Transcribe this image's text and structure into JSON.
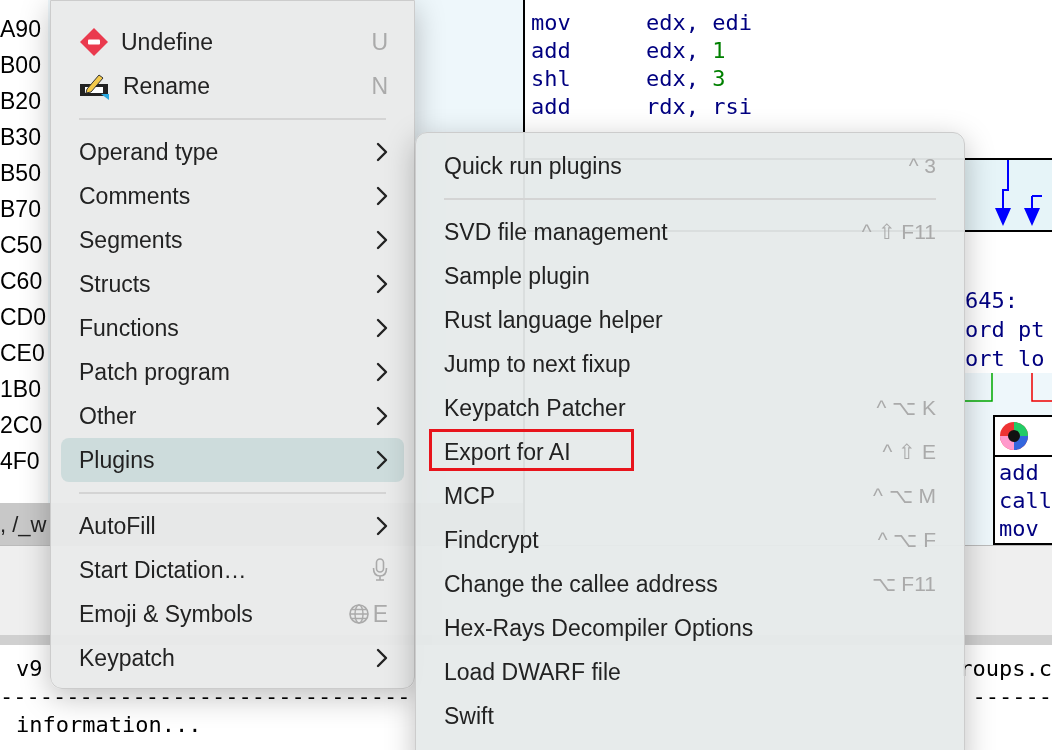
{
  "background": {
    "addresses": [
      "A90",
      "B00",
      "B20",
      "B30",
      "B50",
      "B70",
      "C50",
      "C60",
      "CD0",
      "CE0",
      "1B0",
      "2C0",
      "4F0"
    ],
    "tab_fragment": ", /_w",
    "code": [
      {
        "mnemonic": "mov",
        "operands": [
          {
            "text": "edx, edi",
            "kind": "reg"
          }
        ]
      },
      {
        "mnemonic": "add",
        "operands": [
          {
            "text": "edx, ",
            "kind": "reg"
          },
          {
            "text": "1",
            "kind": "num"
          }
        ]
      },
      {
        "mnemonic": "shl",
        "operands": [
          {
            "text": "edx, ",
            "kind": "reg"
          },
          {
            "text": "3",
            "kind": "num"
          }
        ]
      },
      {
        "mnemonic": "add",
        "operands": [
          {
            "text": "rdx, rsi",
            "kind": "reg"
          }
        ]
      }
    ],
    "graph_text": [
      "645:",
      "ord pt",
      "ort lo"
    ],
    "graph_block": [
      "add",
      "call",
      "mov"
    ],
    "output": {
      "version": "v9",
      "tail": "roups.c",
      "rule_left": "-------------------------------",
      "rule_right": "------",
      "info": "information..."
    }
  },
  "context_menu": [
    {
      "kind": "undefine",
      "label": "Undefine",
      "shortcut": "U",
      "submenu": false,
      "selected": false
    },
    {
      "kind": "rename",
      "label": "Rename",
      "shortcut": "N",
      "submenu": false,
      "selected": false
    },
    {
      "kind": "separator"
    },
    {
      "kind": "item",
      "label": "Operand type",
      "submenu": true,
      "selected": false
    },
    {
      "kind": "item",
      "label": "Comments",
      "submenu": true,
      "selected": false
    },
    {
      "kind": "item",
      "label": "Segments",
      "submenu": true,
      "selected": false
    },
    {
      "kind": "item",
      "label": "Structs",
      "submenu": true,
      "selected": false
    },
    {
      "kind": "item",
      "label": "Functions",
      "submenu": true,
      "selected": false
    },
    {
      "kind": "item",
      "label": "Patch program",
      "submenu": true,
      "selected": false
    },
    {
      "kind": "item",
      "label": "Other",
      "submenu": true,
      "selected": false
    },
    {
      "kind": "item",
      "label": "Plugins",
      "submenu": true,
      "selected": true
    },
    {
      "kind": "separator"
    },
    {
      "kind": "item",
      "label": "AutoFill",
      "submenu": true,
      "selected": false
    },
    {
      "kind": "dictation",
      "label": "Start Dictation…",
      "submenu": false,
      "selected": false
    },
    {
      "kind": "emoji",
      "label": "Emoji & Symbols",
      "shortcut": "E",
      "submenu": false,
      "selected": false
    },
    {
      "kind": "item",
      "label": "Keypatch",
      "submenu": true,
      "selected": false
    }
  ],
  "plugins_menu": [
    {
      "kind": "item",
      "label": "Quick run plugins",
      "shortcut": "^ 3",
      "annotated": false
    },
    {
      "kind": "separator"
    },
    {
      "kind": "item",
      "label": "SVD file management",
      "shortcut": "^ ⇧ F11",
      "annotated": false
    },
    {
      "kind": "item",
      "label": "Sample plugin",
      "annotated": false
    },
    {
      "kind": "item",
      "label": "Rust language helper",
      "annotated": false
    },
    {
      "kind": "item",
      "label": "Jump to next fixup",
      "annotated": false
    },
    {
      "kind": "item",
      "label": "Keypatch Patcher",
      "shortcut": "^ ⌥ K",
      "annotated": false
    },
    {
      "kind": "item",
      "label": "Export for AI",
      "shortcut": "^ ⇧ E",
      "annotated": true
    },
    {
      "kind": "item",
      "label": "MCP",
      "shortcut": "^ ⌥ M",
      "annotated": false
    },
    {
      "kind": "item",
      "label": "Findcrypt",
      "shortcut": "^ ⌥ F",
      "annotated": false
    },
    {
      "kind": "item",
      "label": "Change the callee address",
      "shortcut": "⌥ F11",
      "annotated": false
    },
    {
      "kind": "item",
      "label": "Hex-Rays Decompiler Options",
      "annotated": false
    },
    {
      "kind": "item",
      "label": "Load DWARF file",
      "annotated": false
    },
    {
      "kind": "item",
      "label": "Swift",
      "annotated": false
    }
  ]
}
